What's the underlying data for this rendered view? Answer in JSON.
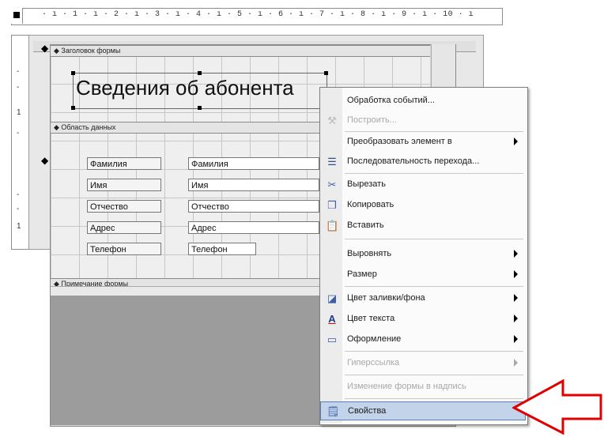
{
  "ruler": {
    "marks": "· ı · 1 · ı · 2 · ı · 3 · ı · 4 · ı · 5 · ı · 6 · ı · 7 · ı · 8 · ı · 9 · ı · 10 · ı"
  },
  "left_ruler": {
    "mark_top": "1",
    "mark_bottom": "1"
  },
  "sections": {
    "header": "Заголовок формы",
    "detail": "Область данных",
    "footer": "Примечание формы"
  },
  "form": {
    "title": "Сведения об абонента",
    "fields": [
      {
        "label": "Фамилия",
        "value": "Фамилия"
      },
      {
        "label": "Имя",
        "value": "Имя"
      },
      {
        "label": "Отчество",
        "value": "Отчество"
      },
      {
        "label": "Адрес",
        "value": "Адрес"
      },
      {
        "label": "Телефон",
        "value": "Телефон"
      }
    ]
  },
  "context_menu": {
    "items": [
      {
        "label": "Обработка событий...",
        "icon": "none",
        "disabled": false,
        "submenu": false
      },
      {
        "label": "Построить...",
        "icon": "build-icon",
        "disabled": true,
        "submenu": false
      },
      {
        "label": "Преобразовать элемент в",
        "icon": "none",
        "disabled": false,
        "submenu": true
      },
      {
        "label": "Последовательность перехода...",
        "icon": "tab-order-icon",
        "disabled": false,
        "submenu": false
      },
      {
        "label": "Вырезать",
        "icon": "scissors-icon",
        "disabled": false,
        "submenu": false
      },
      {
        "label": "Копировать",
        "icon": "copy-icon",
        "disabled": false,
        "submenu": false
      },
      {
        "label": "Вставить",
        "icon": "paste-icon",
        "disabled": false,
        "submenu": false
      },
      {
        "label": "Выровнять",
        "icon": "none",
        "disabled": false,
        "submenu": true
      },
      {
        "label": "Размер",
        "icon": "none",
        "disabled": false,
        "submenu": true
      },
      {
        "label": "Цвет заливки/фона",
        "icon": "fill-color-icon",
        "disabled": false,
        "submenu": true
      },
      {
        "label": "Цвет текста",
        "icon": "font-color-icon",
        "disabled": false,
        "submenu": true
      },
      {
        "label": "Оформление",
        "icon": "special-effect-icon",
        "disabled": false,
        "submenu": true
      },
      {
        "label": "Гиперссылка",
        "icon": "none",
        "disabled": true,
        "submenu": true
      },
      {
        "label": "Изменение формы в надпись",
        "icon": "none",
        "disabled": true,
        "submenu": false
      },
      {
        "label": "Свойства",
        "icon": "properties-icon",
        "disabled": false,
        "submenu": false,
        "highlighted": true
      }
    ]
  },
  "colors": {
    "menu_highlight": "#c3d3ea",
    "arrow_red": "#e10000"
  }
}
